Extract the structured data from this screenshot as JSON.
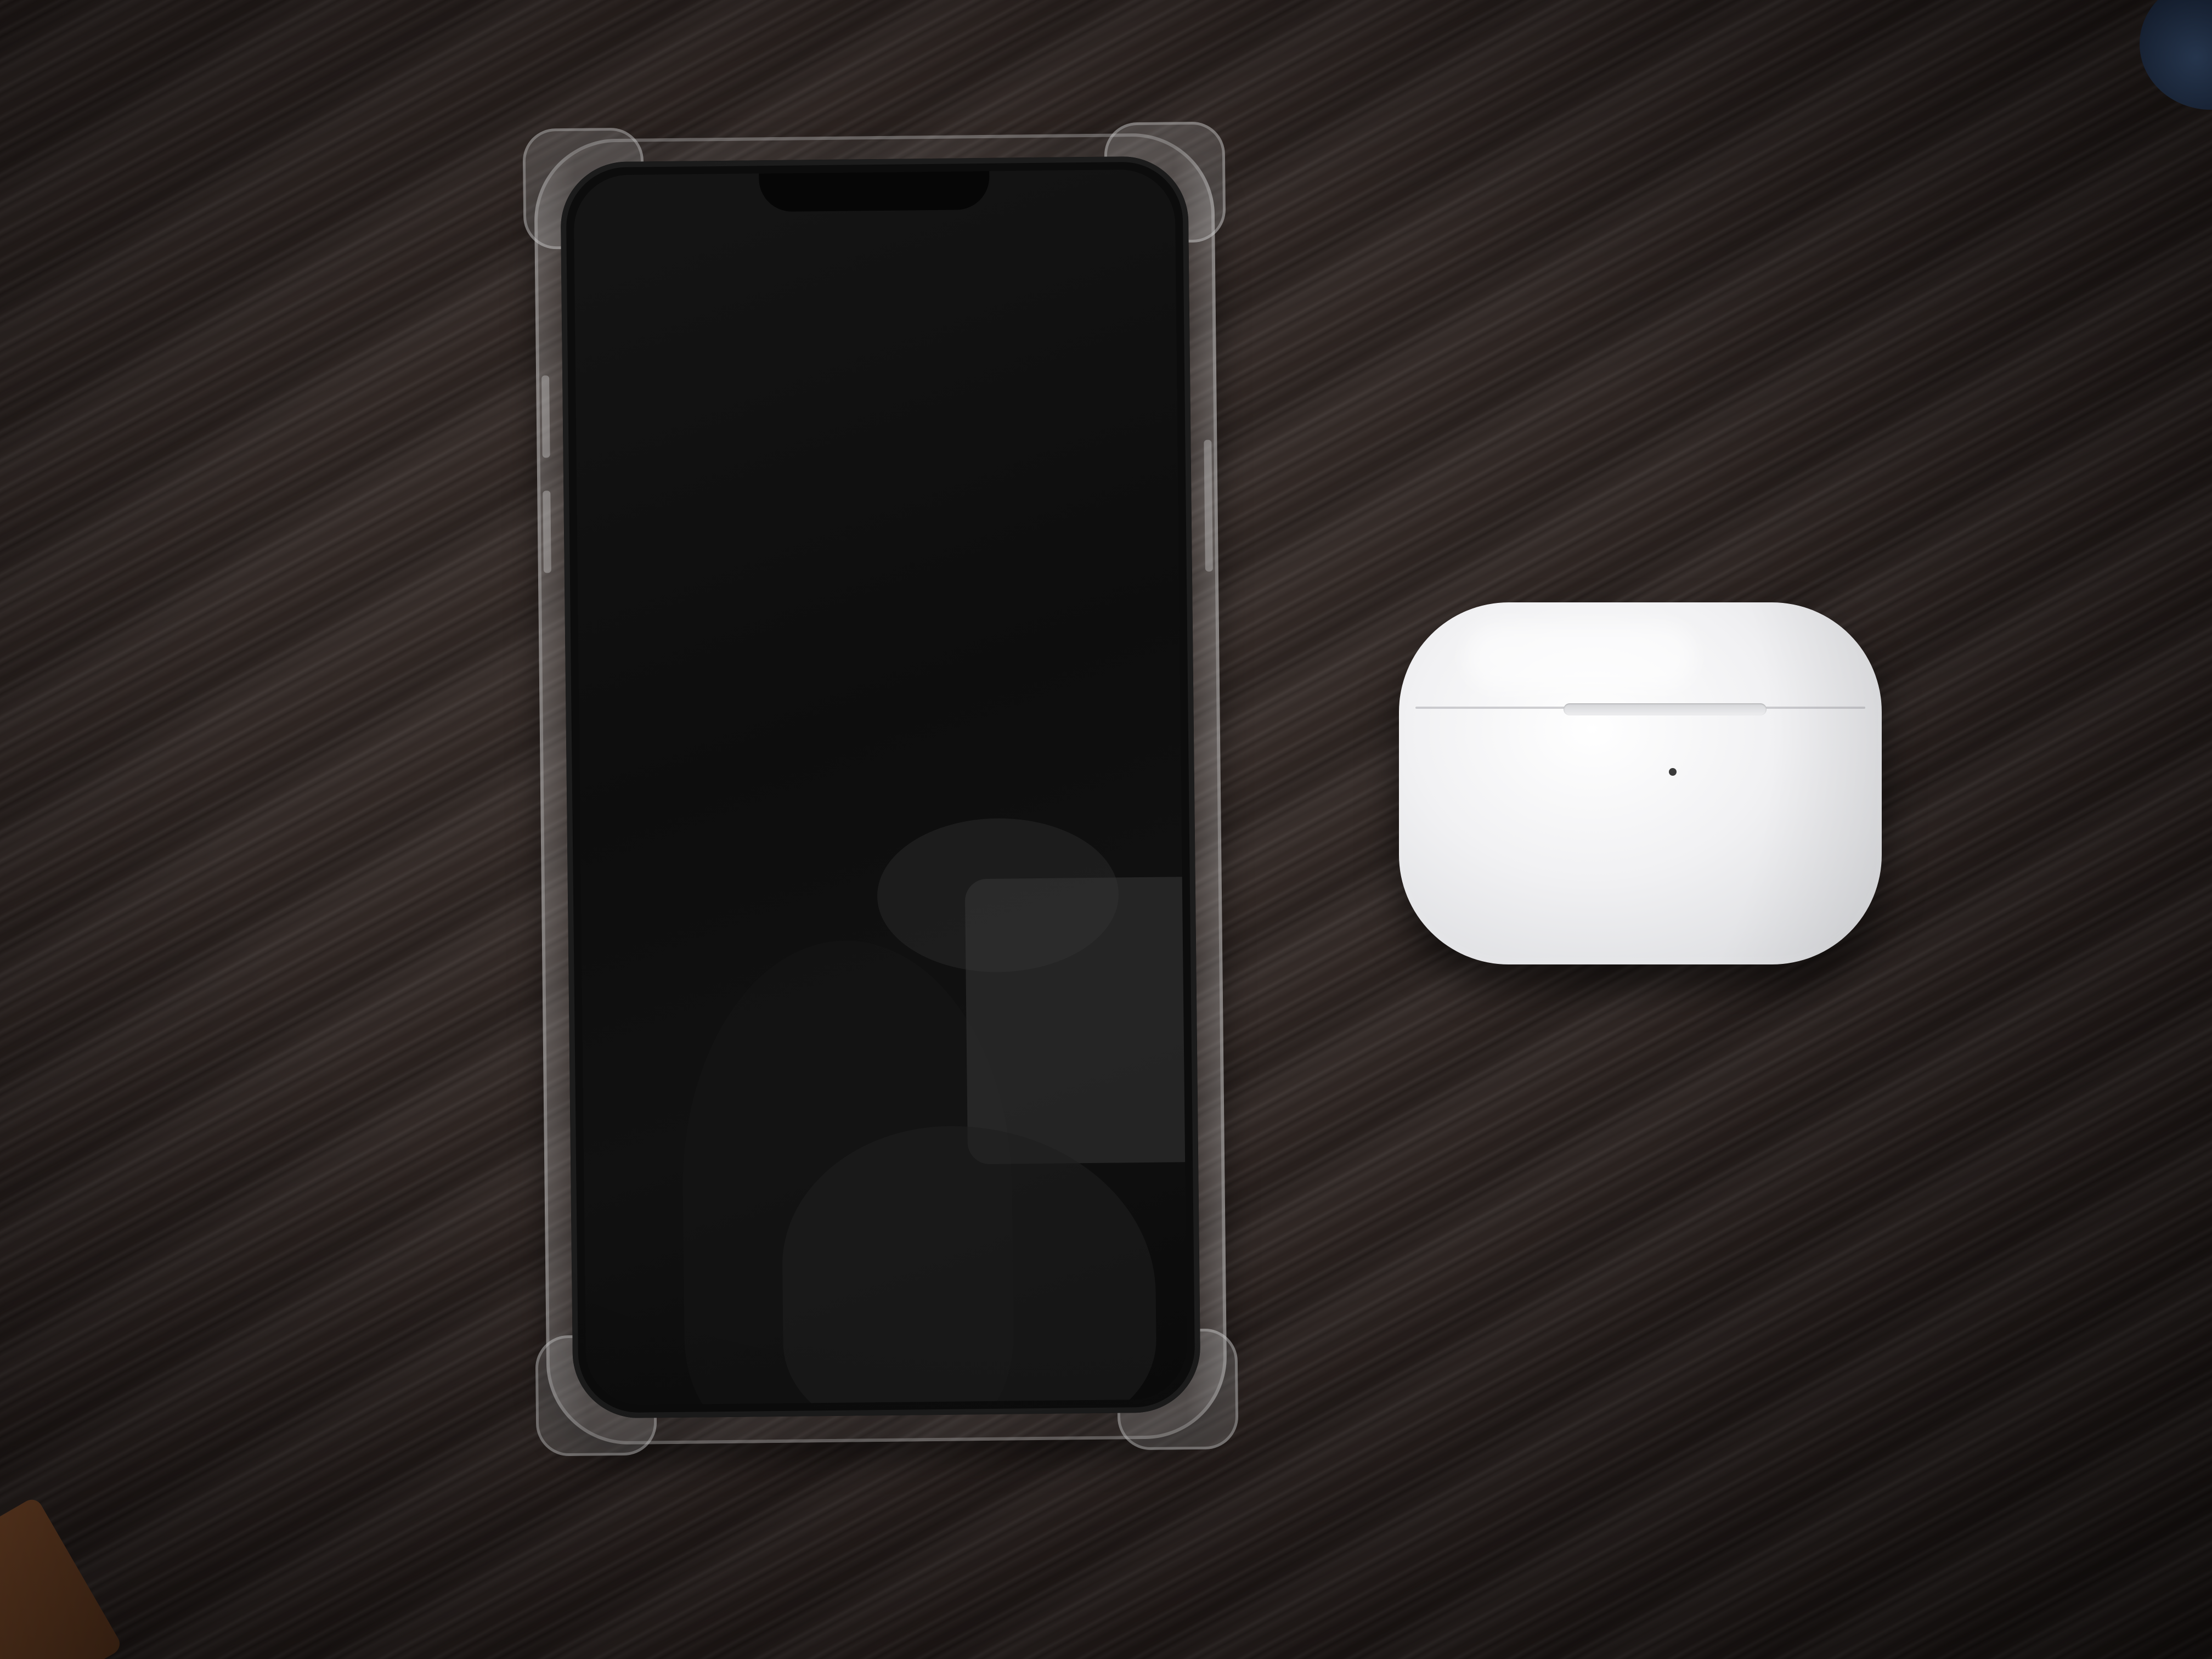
{
  "scene": {
    "description_free": true,
    "objects": [
      {
        "name": "smartphone",
        "color": "#0c0c0c",
        "case": "clear"
      },
      {
        "name": "earbuds-charging-case",
        "color": "#f1f1f3"
      }
    ],
    "surface_color": "#2a2220"
  }
}
